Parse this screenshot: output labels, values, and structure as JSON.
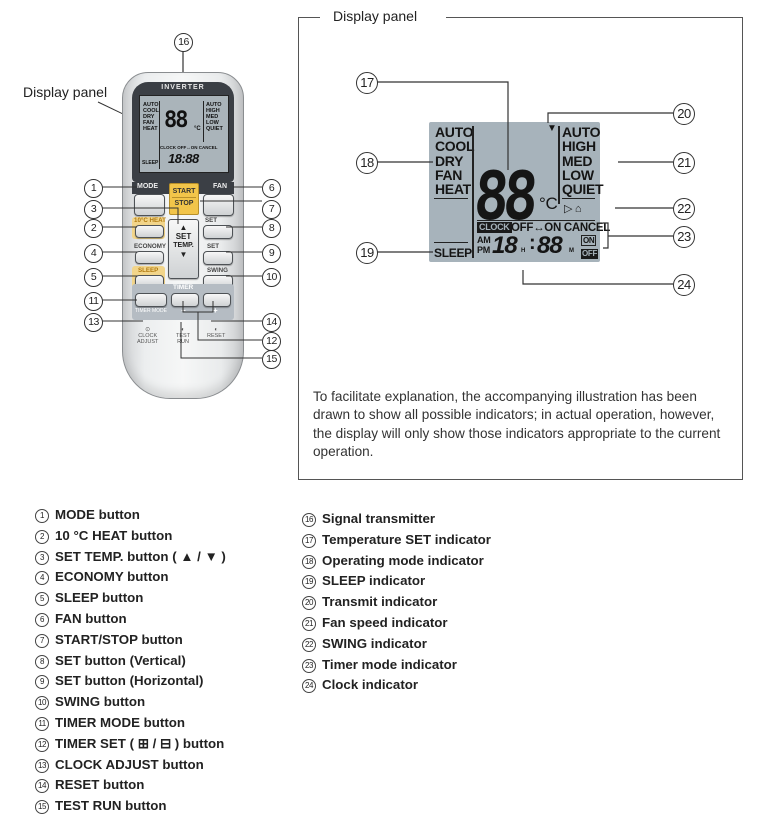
{
  "remote": {
    "label_display_panel": "Display panel",
    "brand_strip": "INVERTER",
    "buttons": {
      "mode": "MODE",
      "fan": "FAN",
      "start": "START",
      "stop": "STOP",
      "heat10": "10°C HEAT",
      "set_vertical": "SET",
      "economy": "ECONOMY",
      "set_temp_line1": "SET",
      "set_temp_line2": "TEMP.",
      "set_horizontal": "SET",
      "sleep": "SLEEP",
      "swing": "SWING",
      "timer": "TIMER",
      "timer_mode": "TIMER MODE",
      "minus": "−",
      "plus": "+",
      "clock_adjust_1": "CLOCK",
      "clock_adjust_2": "ADJUST",
      "test_run_1": "TEST",
      "test_run_2": "RUN",
      "reset": "RESET"
    },
    "mini_lcd": {
      "modes": [
        "AUTO",
        "COOL",
        "DRY",
        "FAN",
        "HEAT"
      ],
      "fans": [
        "AUTO",
        "HIGH",
        "MED",
        "LOW",
        "QUIET"
      ],
      "digits": "88",
      "unit": "°C",
      "timer_row": "CLOCK OFF↔ON CANCEL",
      "sleep": "SLEEP",
      "time": "18:88"
    },
    "callouts": [
      "1",
      "2",
      "3",
      "4",
      "5",
      "6",
      "7",
      "8",
      "9",
      "10",
      "11",
      "12",
      "13",
      "14",
      "15",
      "16"
    ]
  },
  "display_panel": {
    "title": "Display panel",
    "lcd": {
      "modes": [
        "AUTO",
        "COOL",
        "DRY",
        "FAN",
        "HEAT"
      ],
      "fans": [
        "AUTO",
        "HIGH",
        "MED",
        "LOW",
        "QUIET"
      ],
      "temp_digits": "88",
      "unit": "°C",
      "swing_icons": "▷ ⌂",
      "clock_badge": "CLOCK",
      "timer_text": "OFF↔ON CANCEL",
      "am": "AM",
      "pm": "PM",
      "hours": "18",
      "h": "H",
      "colon": ":",
      "minutes": "88",
      "m": "M",
      "on": "ON",
      "off": "OFF",
      "sleep": "SLEEP",
      "transmit_icon": "▼"
    },
    "callouts": [
      "17",
      "18",
      "19",
      "20",
      "21",
      "22",
      "23",
      "24"
    ],
    "description": "To facilitate explanation, the accompanying illustration has been drawn to show all possible indicators; in actual operation, however, the display will only show those indicators appropriate to the current operation."
  },
  "legend_left": [
    {
      "num": "1",
      "text": "MODE button"
    },
    {
      "num": "2",
      "text": "10 °C HEAT button"
    },
    {
      "num": "3",
      "text": "SET TEMP. button ( ▲ / ▼ )"
    },
    {
      "num": "4",
      "text": "ECONOMY button"
    },
    {
      "num": "5",
      "text": "SLEEP button"
    },
    {
      "num": "6",
      "text": "FAN button"
    },
    {
      "num": "7",
      "text": "START/STOP button"
    },
    {
      "num": "8",
      "text": "SET button (Vertical)"
    },
    {
      "num": "9",
      "text": "SET button (Horizontal)"
    },
    {
      "num": "10",
      "text": "SWING button"
    },
    {
      "num": "11",
      "text": "TIMER MODE button"
    },
    {
      "num": "12",
      "text": "TIMER SET ( ⊞ / ⊟ ) button"
    },
    {
      "num": "13",
      "text": "CLOCK ADJUST button"
    },
    {
      "num": "14",
      "text": "RESET button"
    },
    {
      "num": "15",
      "text": "TEST RUN button"
    }
  ],
  "legend_right": [
    {
      "num": "16",
      "text": "Signal transmitter"
    },
    {
      "num": "17",
      "text": "Temperature SET indicator"
    },
    {
      "num": "18",
      "text": "Operating mode indicator"
    },
    {
      "num": "19",
      "text": "SLEEP indicator"
    },
    {
      "num": "20",
      "text": "Transmit indicator"
    },
    {
      "num": "21",
      "text": "Fan speed indicator"
    },
    {
      "num": "22",
      "text": "SWING indicator"
    },
    {
      "num": "23",
      "text": "Timer mode indicator"
    },
    {
      "num": "24",
      "text": "Clock indicator"
    }
  ]
}
